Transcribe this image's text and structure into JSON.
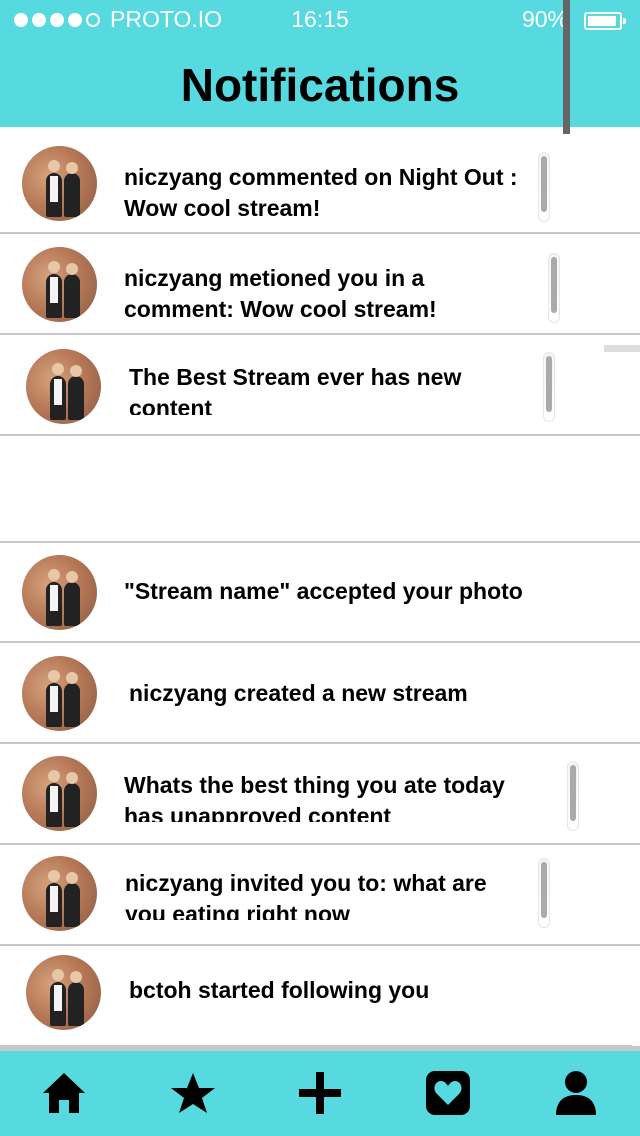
{
  "status_bar": {
    "carrier": "PROTO.IO",
    "time": "16:15",
    "battery": "90%"
  },
  "header": {
    "title": "Notifications"
  },
  "notifications": [
    {
      "text": "niczyang commented on Night Out : Wow cool stream!"
    },
    {
      "text": "niczyang metioned you in a comment: Wow cool stream!"
    },
    {
      "text": "The Best Stream ever has new content"
    },
    {
      "text": "\"Stream name\" accepted your photo"
    },
    {
      "text": "niczyang created a new stream"
    },
    {
      "text": "Whats the best thing you ate today has unapproved content"
    },
    {
      "text": "niczyang invited you to: what are you eating right now"
    },
    {
      "text": "bctoh started following you"
    }
  ],
  "tabbar": {
    "items": [
      {
        "icon": "home-icon"
      },
      {
        "icon": "star-icon"
      },
      {
        "icon": "plus-icon"
      },
      {
        "icon": "heart-icon"
      },
      {
        "icon": "profile-icon"
      }
    ]
  },
  "colors": {
    "accent": "#56dae0",
    "divider": "#c8c8c8"
  }
}
